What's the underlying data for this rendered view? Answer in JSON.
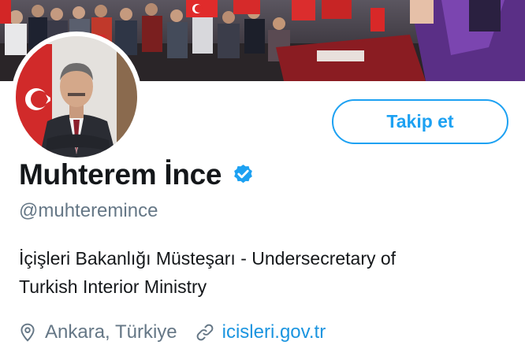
{
  "profile": {
    "display_name": "Muhterem İnce",
    "verified": true,
    "username": "@muhteremince",
    "bio_line1": "İçişleri Bakanlığı Müsteşarı - Undersecretary of",
    "bio_line2": "Turkish Interior Ministry",
    "location": "Ankara, Türkiye",
    "website": "icisleri.gov.tr"
  },
  "actions": {
    "follow_label": "Takip et"
  },
  "icons": {
    "verified": "verified-badge-icon",
    "location": "map-pin-icon",
    "website": "link-icon"
  },
  "colors": {
    "accent": "#1da1f2",
    "link": "#1b95e0",
    "name_text": "#14171a",
    "secondary_text": "#657786"
  }
}
